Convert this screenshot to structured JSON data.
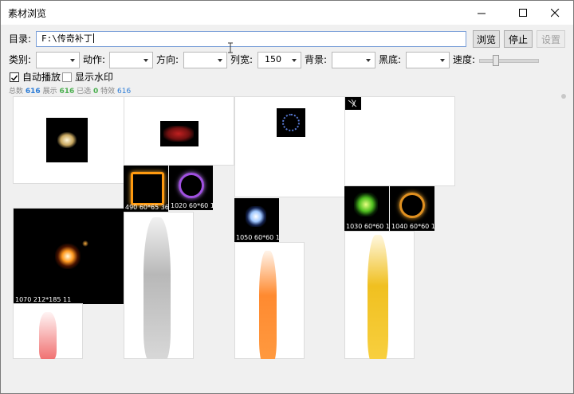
{
  "window": {
    "title": "素材浏览"
  },
  "dir": {
    "label": "目录:",
    "value": "F:\\传奇补丁"
  },
  "buttons": {
    "browse": "浏览",
    "stop": "停止",
    "settings": "设置"
  },
  "filters": [
    {
      "label": "类别:",
      "value": ""
    },
    {
      "label": "动作:",
      "value": ""
    },
    {
      "label": "方向:",
      "value": ""
    },
    {
      "label": "列宽:",
      "value": "150"
    },
    {
      "label": "背景:",
      "value": ""
    },
    {
      "label": "黑底:",
      "value": ""
    }
  ],
  "speed": {
    "label": "速度:",
    "level": 0.25
  },
  "options": {
    "autoplay": {
      "label": "自动播放",
      "checked": true
    },
    "watermark": {
      "label": "显示水印",
      "checked": false
    }
  },
  "stats": [
    {
      "label": "总数",
      "value": "616",
      "color": "#2b7bd6"
    },
    {
      "label": "展示",
      "value": "616",
      "color": "#4caf50"
    },
    {
      "label": "已选",
      "value": "0",
      "color": "#4caf50"
    },
    {
      "label": "特效",
      "value": "616",
      "color": "#2b7bd6"
    }
  ],
  "thumbnails": [
    {
      "caption": "490 60*65 36"
    },
    {
      "caption": "1020 60*60 1"
    },
    {
      "caption": "1050 60*60 1"
    },
    {
      "caption": "1030 60*60 1"
    },
    {
      "caption": "1040 60*60 1"
    },
    {
      "caption": "1070 212*185 11"
    }
  ]
}
